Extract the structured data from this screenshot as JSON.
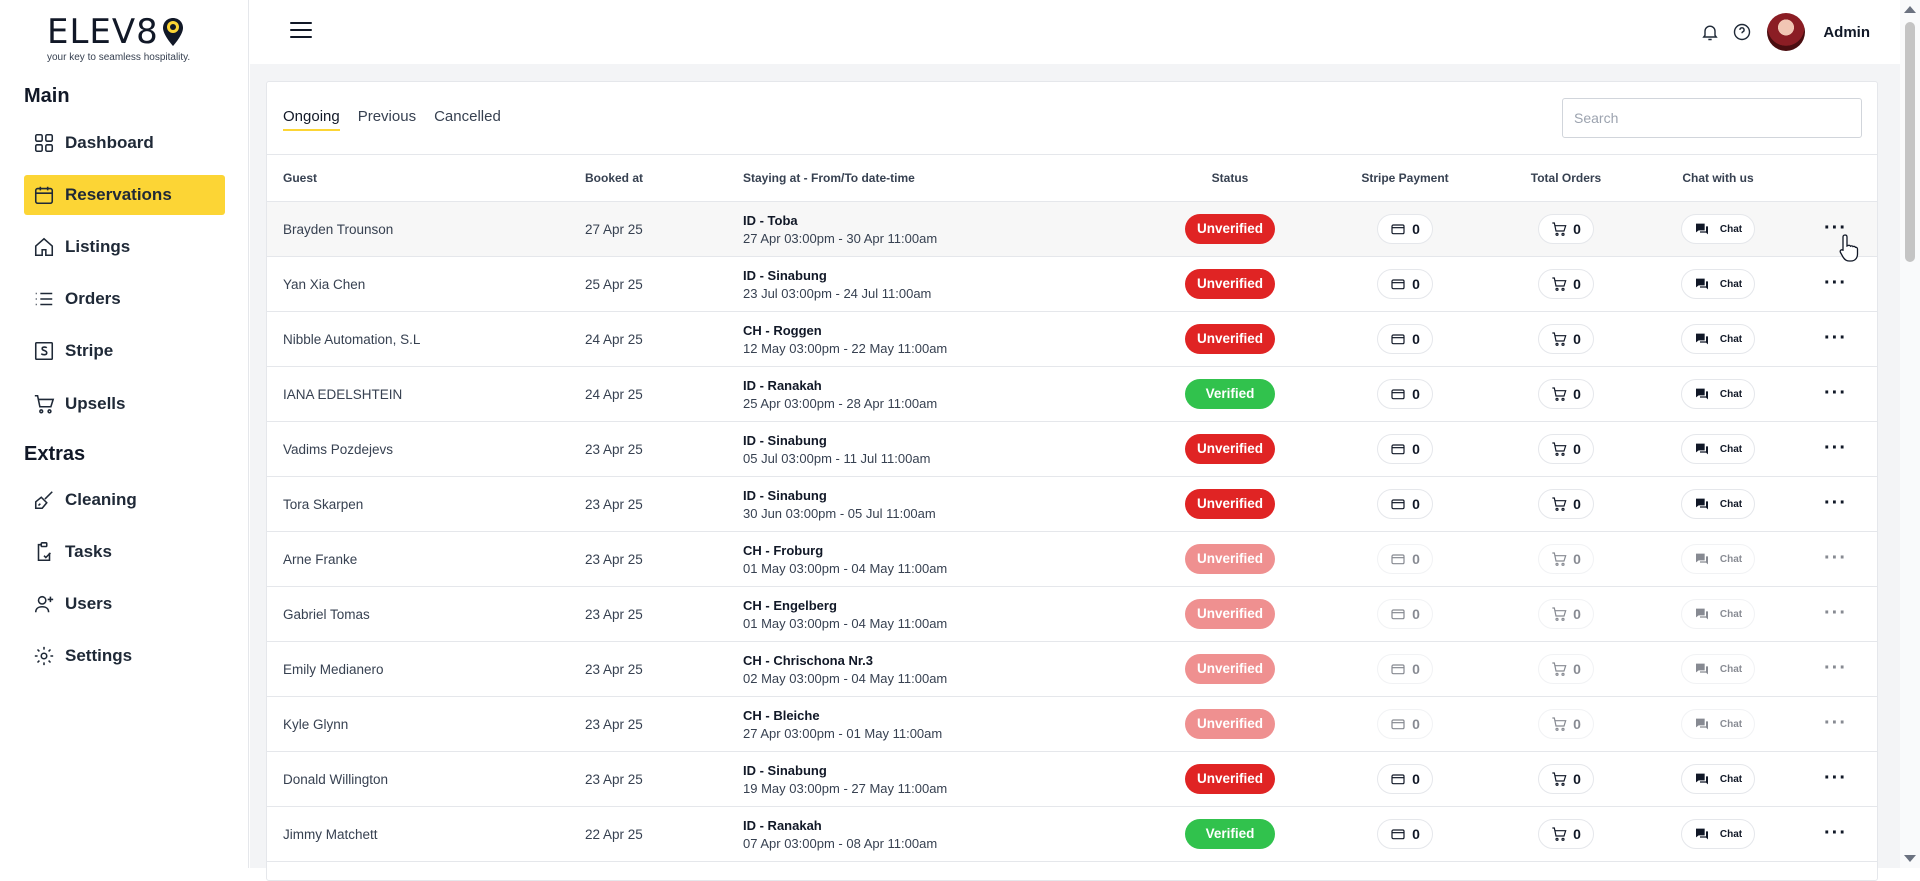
{
  "brand": {
    "logo_text": "ELEV8",
    "tagline": "your key to seamless hospitality.",
    "accent_color": "#fcd535"
  },
  "sidebar": {
    "main_title": "Main",
    "extras_title": "Extras",
    "main_items": [
      {
        "label": "Dashboard",
        "icon": "grid-icon"
      },
      {
        "label": "Reservations",
        "icon": "calendar-icon",
        "active": true
      },
      {
        "label": "Listings",
        "icon": "home-icon"
      },
      {
        "label": "Orders",
        "icon": "list-icon"
      },
      {
        "label": "Stripe",
        "icon": "stripe-icon"
      },
      {
        "label": "Upsells",
        "icon": "cart-icon"
      }
    ],
    "extras_items": [
      {
        "label": "Cleaning",
        "icon": "broom-icon"
      },
      {
        "label": "Tasks",
        "icon": "clipboard-icon"
      },
      {
        "label": "Users",
        "icon": "user-plus-icon"
      },
      {
        "label": "Settings",
        "icon": "gear-icon"
      }
    ]
  },
  "topbar": {
    "user_name": "Admin",
    "icons": [
      "menu-icon",
      "bell-icon",
      "help-icon",
      "avatar"
    ]
  },
  "tabs": [
    {
      "label": "Ongoing",
      "active": true
    },
    {
      "label": "Previous"
    },
    {
      "label": "Cancelled"
    }
  ],
  "search": {
    "placeholder": "Search",
    "value": ""
  },
  "table": {
    "headers": {
      "guest": "Guest",
      "booked": "Booked at",
      "stay": "Staying at - From/To date-time",
      "status": "Status",
      "stripe": "Stripe Payment",
      "orders": "Total Orders",
      "chat": "Chat with us"
    },
    "chat_label": "Chat",
    "status_colors": {
      "Unverified": "#e02424",
      "Verified": "#31c24d"
    },
    "rows": [
      {
        "guest": "Brayden Trounson",
        "booked": "27 Apr 25",
        "stay": "ID - Toba",
        "dates": "27 Apr 03:00pm - 30 Apr 11:00am",
        "status": "Unverified",
        "stripe": "0",
        "orders": "0"
      },
      {
        "guest": "Yan Xia Chen",
        "booked": "25 Apr 25",
        "stay": "ID - Sinabung",
        "dates": "23 Jul 03:00pm - 24 Jul 11:00am",
        "status": "Unverified",
        "stripe": "0",
        "orders": "0"
      },
      {
        "guest": "Nibble Automation, S.L",
        "booked": "24 Apr 25",
        "stay": "CH - Roggen",
        "dates": "12 May 03:00pm - 22 May 11:00am",
        "status": "Unverified",
        "stripe": "0",
        "orders": "0"
      },
      {
        "guest": "IANA EDELSHTEIN",
        "booked": "24 Apr 25",
        "stay": "ID - Ranakah",
        "dates": "25 Apr 03:00pm - 28 Apr 11:00am",
        "status": "Verified",
        "stripe": "0",
        "orders": "0"
      },
      {
        "guest": "Vadims Pozdejevs",
        "booked": "23 Apr 25",
        "stay": "ID - Sinabung",
        "dates": "05 Jul 03:00pm - 11 Jul 11:00am",
        "status": "Unverified",
        "stripe": "0",
        "orders": "0"
      },
      {
        "guest": "Tora Skarpen",
        "booked": "23 Apr 25",
        "stay": "ID - Sinabung",
        "dates": "30 Jun 03:00pm - 05 Jul 11:00am",
        "status": "Unverified",
        "stripe": "0",
        "orders": "0"
      },
      {
        "guest": "Arne Franke",
        "booked": "23 Apr 25",
        "stay": "CH - Froburg",
        "dates": "01 May 03:00pm - 04 May 11:00am",
        "status": "Unverified",
        "stripe": "0",
        "orders": "0"
      },
      {
        "guest": "Gabriel Tomas",
        "booked": "23 Apr 25",
        "stay": "CH - Engelberg",
        "dates": "01 May 03:00pm - 04 May 11:00am",
        "status": "Unverified",
        "stripe": "0",
        "orders": "0"
      },
      {
        "guest": "Emily Medianero",
        "booked": "23 Apr 25",
        "stay": "CH - Chrischona Nr.3",
        "dates": "02 May 03:00pm - 04 May 11:00am",
        "status": "Unverified",
        "stripe": "0",
        "orders": "0"
      },
      {
        "guest": "Kyle Glynn",
        "booked": "23 Apr 25",
        "stay": "CH - Bleiche",
        "dates": "27 Apr 03:00pm - 01 May 11:00am",
        "status": "Unverified",
        "stripe": "0",
        "orders": "0"
      },
      {
        "guest": "Donald Willington",
        "booked": "23 Apr 25",
        "stay": "ID - Sinabung",
        "dates": "19 May 03:00pm - 27 May 11:00am",
        "status": "Unverified",
        "stripe": "0",
        "orders": "0"
      },
      {
        "guest": "Jimmy Matchett",
        "booked": "22 Apr 25",
        "stay": "ID - Ranakah",
        "dates": "07 Apr 03:00pm - 08 Apr 11:00am",
        "status": "Verified",
        "stripe": "0",
        "orders": "0"
      }
    ]
  }
}
